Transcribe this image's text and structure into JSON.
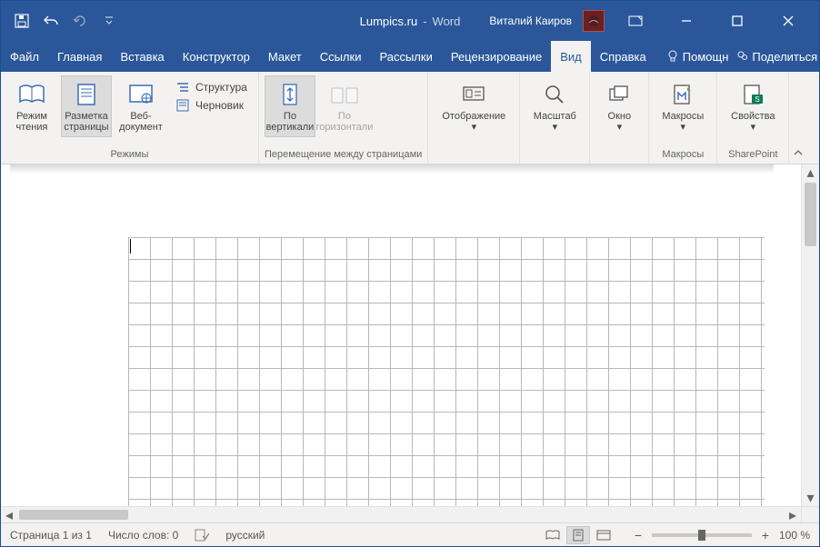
{
  "titlebar": {
    "doc_title": "Lumpics.ru",
    "app_sep": "-",
    "app_name": "Word",
    "user_name": "Виталий Каиров"
  },
  "tabs": {
    "file": "Файл",
    "home": "Главная",
    "insert": "Вставка",
    "design": "Конструктор",
    "layout": "Макет",
    "references": "Ссылки",
    "mailings": "Рассылки",
    "review": "Рецензирование",
    "view": "Вид",
    "help": "Справка",
    "tell_me": "Помощн",
    "share": "Поделиться"
  },
  "ribbon": {
    "views_group": "Режимы",
    "read_mode_l1": "Режим",
    "read_mode_l2": "чтения",
    "print_layout_l1": "Разметка",
    "print_layout_l2": "страницы",
    "web_layout_l1": "Веб-",
    "web_layout_l2": "документ",
    "outline": "Структура",
    "draft": "Черновик",
    "page_movement_group": "Перемещение между страницами",
    "vertical_l1": "По",
    "vertical_l2": "вертикали",
    "horizontal_l1": "По",
    "horizontal_l2": "горизонтали",
    "show_group": "",
    "show_btn": "Отображение",
    "zoom_group": "",
    "zoom_btn": "Масштаб",
    "window_group": "",
    "window_btn": "Окно",
    "macros_group": "Макросы",
    "macros_btn": "Макросы",
    "sharepoint_group": "SharePoint",
    "properties_btn": "Свойства"
  },
  "statusbar": {
    "page": "Страница 1 из 1",
    "words": "Число слов: 0",
    "language": "русский",
    "zoom_value": "100 %"
  }
}
